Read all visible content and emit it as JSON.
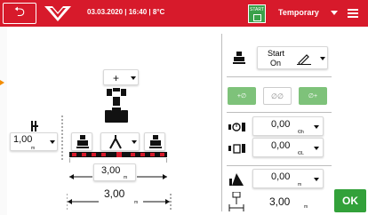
{
  "header": {
    "info": "03.03.2020 | 16:40 | 8°C",
    "start_label": "START",
    "mode": "Temporary"
  },
  "implement": {
    "top_selector": "+",
    "left_value": "1,00",
    "left_unit": "m",
    "working_width": "3,00",
    "working_width_unit": "m",
    "total_width": "3,00",
    "total_width_unit": "m"
  },
  "right_panel": {
    "start_line1": "Start",
    "start_line2": "On",
    "rate1_value": "0,00",
    "rate1_unit": "€/h",
    "rate2_value": "0,00",
    "rate2_unit": "€/L",
    "area_value": "0,00",
    "area_unit": "m",
    "width_value": "3,00",
    "width_unit": "m"
  },
  "footer": {
    "ok_label": "OK"
  },
  "colors": {
    "header": "#d71a2b",
    "accent_green": "#32a13a",
    "toggle_green": "#7ec27a"
  }
}
